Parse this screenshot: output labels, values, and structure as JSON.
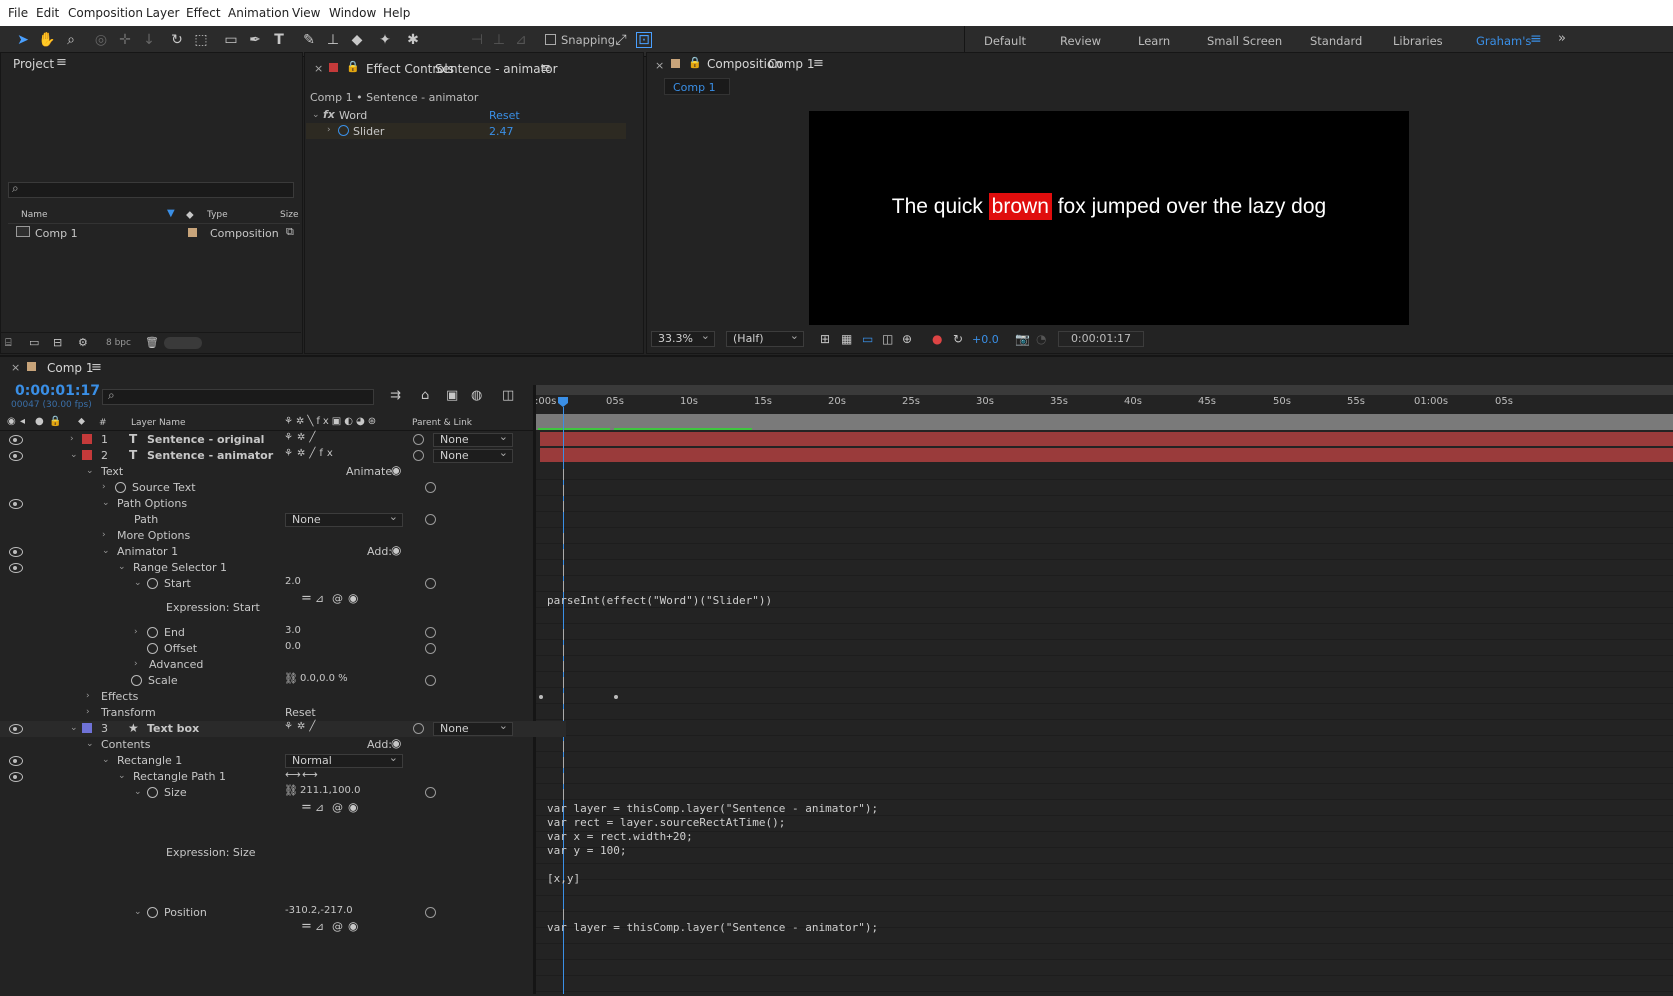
{
  "menubar": [
    "File",
    "Edit",
    "Composition",
    "Layer",
    "Effect",
    "Animation",
    "View",
    "Window",
    "Help"
  ],
  "toolbar": {
    "snapping": "Snapping"
  },
  "workspaces": [
    "Default",
    "Review",
    "Learn",
    "Small Screen",
    "Standard",
    "Libraries",
    "Graham's"
  ],
  "project": {
    "title": "Project",
    "columns": {
      "name": "Name",
      "type": "Type",
      "size": "Size"
    },
    "items": [
      {
        "name": "Comp 1",
        "type": "Composition"
      }
    ],
    "bpc": "8 bpc"
  },
  "effect_controls": {
    "title": "Effect Controls",
    "layer": "Sentence - animator",
    "breadcrumb": "Comp 1 • Sentence - animator",
    "effect_name": "Word",
    "reset": "Reset",
    "slider_label": "Slider",
    "slider_value": "2.47"
  },
  "composition": {
    "title": "Composition",
    "comp": "Comp 1",
    "tab": "Comp 1",
    "sentence": {
      "before": "The quick",
      "highlight": "brown",
      "after": "fox jumped over the lazy dog"
    },
    "zoom": "33.3%",
    "resolution": "(Half)",
    "exposure": "+0.0",
    "timecode": "0:00:01:17"
  },
  "timeline": {
    "tab": "Comp 1",
    "timecode": "0:00:01:17",
    "frames": "00047 (30.00 fps)",
    "col_layer_name": "Layer Name",
    "col_parent": "Parent & Link",
    "col_num": "#",
    "ruler": [
      ":00s",
      "05s",
      "10s",
      "15s",
      "20s",
      "25s",
      "30s",
      "35s",
      "40s",
      "45s",
      "50s",
      "55s",
      "01:00s",
      "05s"
    ],
    "layers": [
      {
        "num": "1",
        "name": "Sentence - original",
        "parent": "None",
        "color": "#c43a3a"
      },
      {
        "num": "2",
        "name": "Sentence - animator",
        "parent": "None",
        "color": "#c43a3a"
      },
      {
        "num": "3",
        "name": "Text box",
        "parent": "None",
        "color": "#6f72d6"
      }
    ],
    "props": {
      "text": "Text",
      "animate": "Animate:",
      "source_text": "Source Text",
      "path_options": "Path Options",
      "path": "Path",
      "path_value": "None",
      "more_options": "More Options",
      "animator1": "Animator 1",
      "add": "Add:",
      "range_selector": "Range Selector 1",
      "start": "Start",
      "start_value": "2.0",
      "expr_start": "Expression: Start",
      "end": "End",
      "end_value": "3.0",
      "offset": "Offset",
      "offset_value": "0.0",
      "advanced": "Advanced",
      "scale": "Scale",
      "scale_value": "0.0,0.0 %",
      "effects": "Effects",
      "transform": "Transform",
      "reset": "Reset",
      "contents": "Contents",
      "rectangle1": "Rectangle 1",
      "rect_mode": "Normal",
      "rect_path": "Rectangle Path 1",
      "size": "Size",
      "size_value": "211.1,100.0",
      "expr_size": "Expression: Size",
      "position": "Position",
      "position_value": "-310.2,-217.0"
    },
    "expr_start_code": "parseInt(effect(\"Word\")(\"Slider\"))",
    "expr_size_code": [
      "var layer = thisComp.layer(\"Sentence - animator\");",
      "var rect = layer.sourceRectAtTime();",
      "var x = rect.width+20;",
      "var y = 100;",
      "",
      "[x,y]"
    ],
    "expr_position_code": "var layer = thisComp.layer(\"Sentence - animator\");"
  }
}
